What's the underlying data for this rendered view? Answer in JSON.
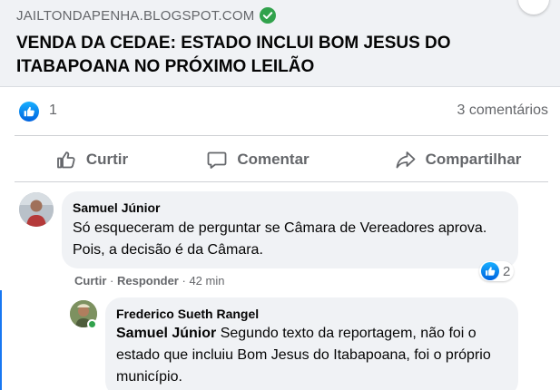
{
  "link_preview": {
    "domain": "JAILTONDAPENHA.BLOGSPOT.COM",
    "headline": "VENDA DA CEDAE: ESTADO INCLUI BOM JESUS DO ITABAPOANA NO PRÓXIMO LEILÃO"
  },
  "reactions": {
    "like_count": "1",
    "comments_count": "3 comentários"
  },
  "actions": {
    "like": "Curtir",
    "comment": "Comentar",
    "share": "Compartilhar"
  },
  "comments": [
    {
      "author": "Samuel Júnior",
      "text": "Só esqueceram de perguntar se Câmara de Vereadores aprova. Pois, a decisão é da Câmara.",
      "like": "Curtir",
      "reply": "Responder",
      "time": "42 min",
      "reaction_count": "2"
    },
    {
      "author": "Frederico Sueth Rangel",
      "mention": "Samuel Júnior",
      "text": "Segundo texto da reportagem, não foi o estado que incluiu Bom Jesus do Itabapoana, foi o próprio município."
    }
  ],
  "colors": {
    "facebook_blue": "#1877f2",
    "verified_green": "#31a24c",
    "bubble_gray": "#f0f2f5",
    "secondary_text": "#65676b"
  }
}
